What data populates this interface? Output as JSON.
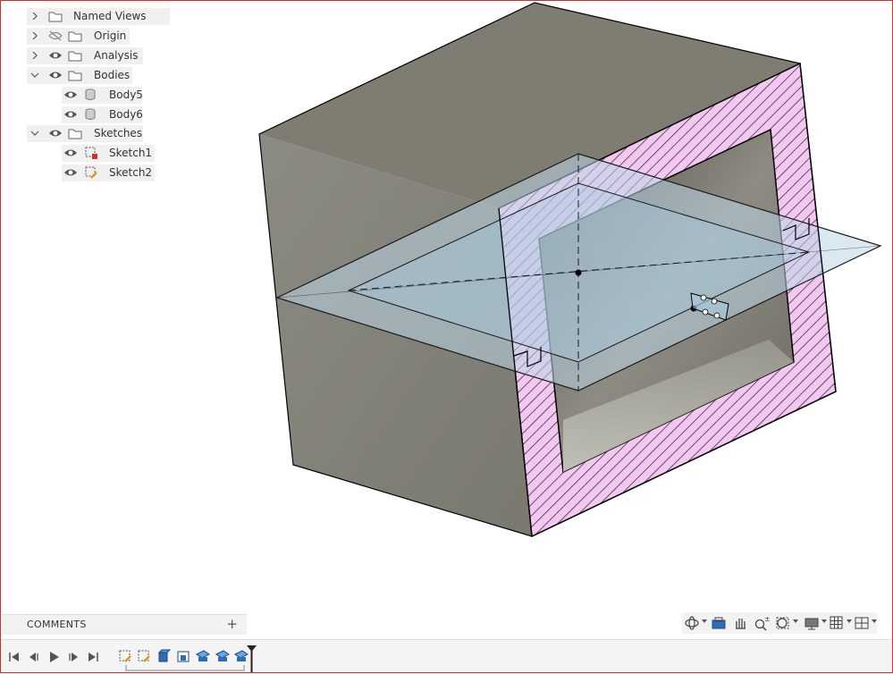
{
  "browser": {
    "items": [
      {
        "label": "Named Views"
      },
      {
        "label": "Origin"
      },
      {
        "label": "Analysis"
      },
      {
        "label": "Bodies"
      },
      {
        "label": "Body5"
      },
      {
        "label": "Body6"
      },
      {
        "label": "Sketches"
      },
      {
        "label": "Sketch1"
      },
      {
        "label": "Sketch2"
      }
    ]
  },
  "comments": {
    "label": "COMMENTS",
    "add": "+"
  },
  "navbar": {
    "tools": [
      "orbit-icon",
      "look-at-icon",
      "pan-icon",
      "zoom-icon",
      "fit-icon",
      "display-settings-icon",
      "grid-icon",
      "viewports-icon"
    ]
  },
  "timeline": {
    "controls": [
      "go-to-start-icon",
      "step-back-icon",
      "play-icon",
      "step-forward-icon",
      "go-to-end-icon"
    ],
    "features": [
      "sketch-feature-icon",
      "sketch-feature-icon",
      "extrude-feature-icon",
      "cut-feature-icon",
      "plane-feature-icon",
      "plane-feature-icon",
      "plane-feature-icon"
    ]
  },
  "colors": {
    "body_top": "#7f7d72",
    "body_left": "#8a8980",
    "section_fill": "#f3c8f0",
    "plane_fill": "#b9d6e6"
  }
}
